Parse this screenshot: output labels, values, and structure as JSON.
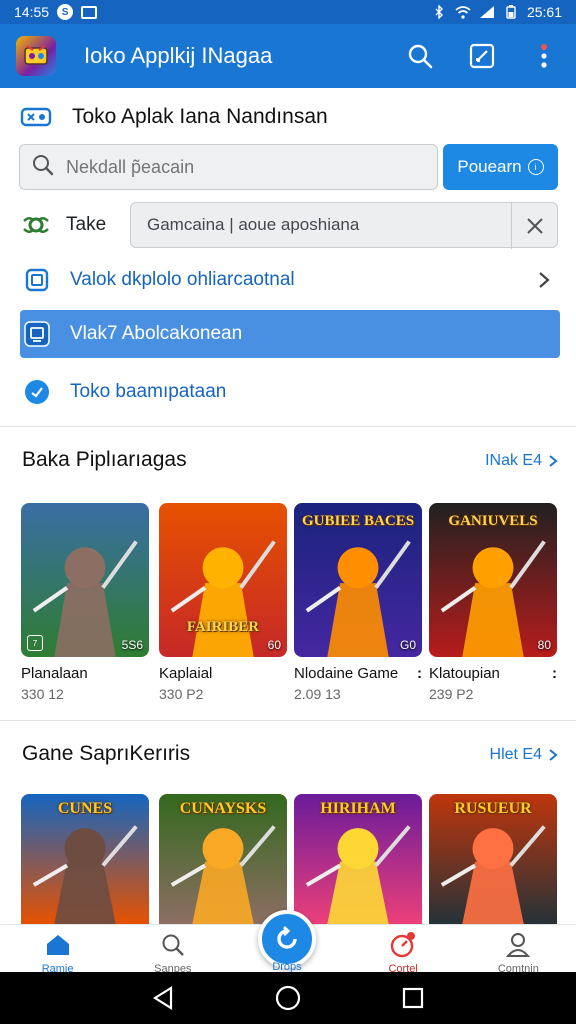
{
  "status_bar": {
    "time_left": "14:55",
    "time_right": "25:61"
  },
  "app_bar": {
    "title": "Ioko Applkij INagaa"
  },
  "store": {
    "title": "Toko Aplak Iana Nandınsan"
  },
  "search": {
    "placeholder": "Nekdall p̃eacain",
    "button_label": "Pouearn"
  },
  "take": {
    "label": "Take",
    "field_value": "Gamcaina | aoue aposhiana"
  },
  "options": [
    {
      "label": "Valok dkplolo ohliarcaotnal",
      "icon": "tablet-icon",
      "selected": false
    },
    {
      "label": "Vlak7 Abolcakonean",
      "icon": "card-icon",
      "selected": true
    },
    {
      "label": "Toko baamıpataan",
      "icon": "check-circle-icon",
      "selected": false
    }
  ],
  "section1": {
    "title": "Baka Piplıarıagas",
    "more": "INak E4",
    "cards": [
      {
        "name": "Planalaan",
        "meta": "330 12",
        "count": "5S6",
        "banner": "",
        "colors": [
          "#3a6ea5",
          "#2e7d32",
          "#8d6e63"
        ]
      },
      {
        "name": "Kaplaial",
        "meta": "330 P2",
        "count": "60",
        "banner": "FAIRIBER",
        "colors": [
          "#e65100",
          "#c62828",
          "#ffb300"
        ]
      },
      {
        "name": "Nlodaine Game",
        "meta": "2.09 13",
        "count": "G0",
        "banner": "GUBIEE BACES",
        "colors": [
          "#1a237e",
          "#4527a0",
          "#ff8f00"
        ]
      },
      {
        "name": "Klatoupian",
        "meta": "239 P2",
        "count": "80",
        "banner": "GANIUVELS",
        "colors": [
          "#212121",
          "#b71c1c",
          "#ffa000"
        ]
      }
    ]
  },
  "section2": {
    "title": "Gane SaprıKerıris",
    "more": "Hlet E4",
    "cards": [
      {
        "banner": "CUNES",
        "colors": [
          "#1565c0",
          "#e65100",
          "#6d4c41"
        ]
      },
      {
        "banner": "CUNAYSKS",
        "colors": [
          "#33691e",
          "#8d6e63",
          "#f9a825"
        ]
      },
      {
        "banner": "HIRIHAM",
        "colors": [
          "#6a1b9a",
          "#ec407a",
          "#fdd835"
        ]
      },
      {
        "banner": "RUSUEUR",
        "colors": [
          "#bf360c",
          "#263238",
          "#ff7043"
        ]
      }
    ]
  },
  "bottom_nav": [
    {
      "label": "Ramie",
      "icon": "home-icon"
    },
    {
      "label": "Sanpes",
      "icon": "search-icon"
    },
    {
      "label": "Drops",
      "icon": "refresh-icon"
    },
    {
      "label": "Cortel",
      "icon": "notification-icon"
    },
    {
      "label": "Comtnin",
      "icon": "profile-icon"
    }
  ]
}
